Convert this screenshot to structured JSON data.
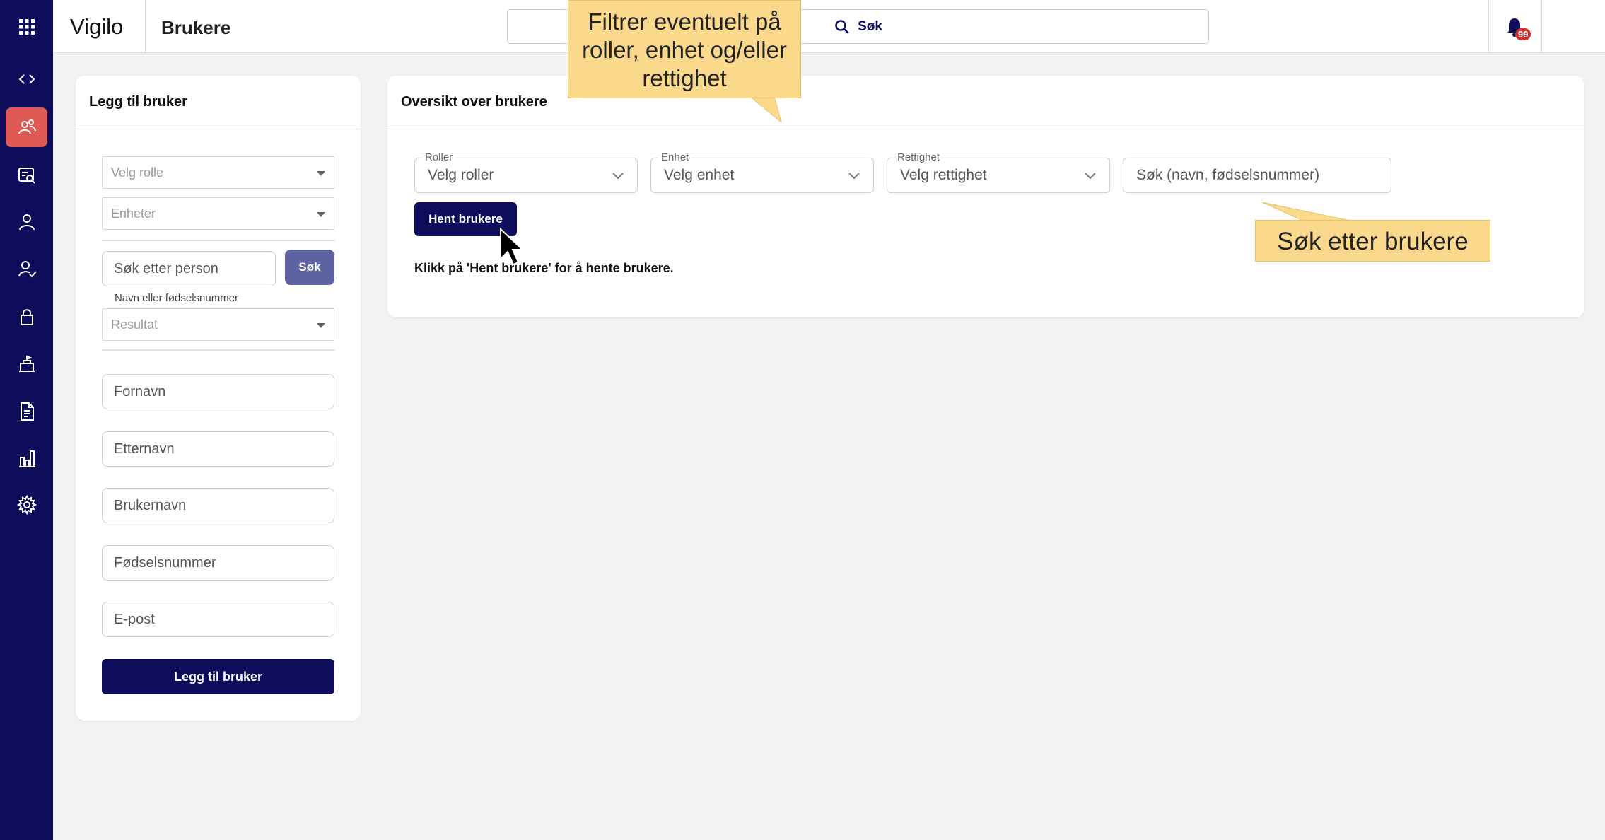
{
  "sidebar": {
    "items": [
      {
        "icon": "grid-icon"
      },
      {
        "icon": "code-icon"
      },
      {
        "icon": "users-icon",
        "active": true
      },
      {
        "icon": "search-users-icon"
      },
      {
        "icon": "person-icon"
      },
      {
        "icon": "person-check-icon"
      },
      {
        "icon": "lock-icon"
      },
      {
        "icon": "school-icon"
      },
      {
        "icon": "document-icon"
      },
      {
        "icon": "bar-chart-icon"
      },
      {
        "icon": "gear-icon"
      }
    ],
    "colors": {
      "background": "#0d0d5c",
      "active": "#e05a55"
    }
  },
  "header": {
    "app_name": "Vigilo",
    "page_name": "Brukere",
    "search_label": "Søk",
    "notification_count": "99"
  },
  "left_card": {
    "title": "Legg til bruker",
    "role_select": "Velg rolle",
    "units_select": "Enheter",
    "person_search_placeholder": "Søk etter person",
    "search_button": "Søk",
    "search_hint": "Navn eller fødselsnummer",
    "result_select": "Resultat",
    "first_name_placeholder": "Fornavn",
    "last_name_placeholder": "Etternavn",
    "username_placeholder": "Brukernavn",
    "ssn_placeholder": "Fødselsnummer",
    "email_placeholder": "E-post",
    "add_button": "Legg til bruker"
  },
  "right_card": {
    "title": "Oversikt over brukere",
    "filters": {
      "roles_label": "Roller",
      "roles_value": "Velg roller",
      "unit_label": "Enhet",
      "unit_value": "Velg enhet",
      "permission_label": "Rettighet",
      "permission_value": "Velg rettighet"
    },
    "search_placeholder": "Søk (navn, fødselsnummer)",
    "fetch_button": "Hent brukere",
    "info_text": "Klikk på 'Hent brukere' for å hente brukere."
  },
  "callouts": {
    "filter_tip": "Filtrer eventuelt på roller, enhet og/eller rettighet",
    "search_tip": "Søk etter brukere"
  }
}
